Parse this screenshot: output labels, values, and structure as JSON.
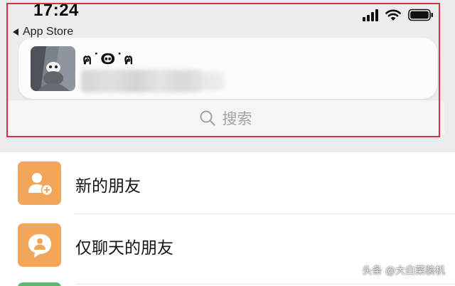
{
  "status_bar": {
    "time": "17:24",
    "icons": [
      "cellular-signal-icon",
      "wifi-icon",
      "battery-icon"
    ]
  },
  "back_link": {
    "label": "App Store"
  },
  "notification": {
    "title": "ฅ˙Ꙫ˙ฅ",
    "thumbnail": "avatar-image"
  },
  "search": {
    "placeholder": "搜索"
  },
  "contacts_menu": {
    "items": [
      {
        "label": "新的朋友",
        "icon": "add-friend-icon"
      },
      {
        "label": "仅聊天的朋友",
        "icon": "chat-only-friends-icon"
      }
    ]
  },
  "watermark": {
    "text": "头条 @大白菜装机"
  },
  "colors": {
    "highlight_border": "#d9323f",
    "menu_icon_bg": "#f2a65a",
    "top_area_bg": "#ececee"
  }
}
